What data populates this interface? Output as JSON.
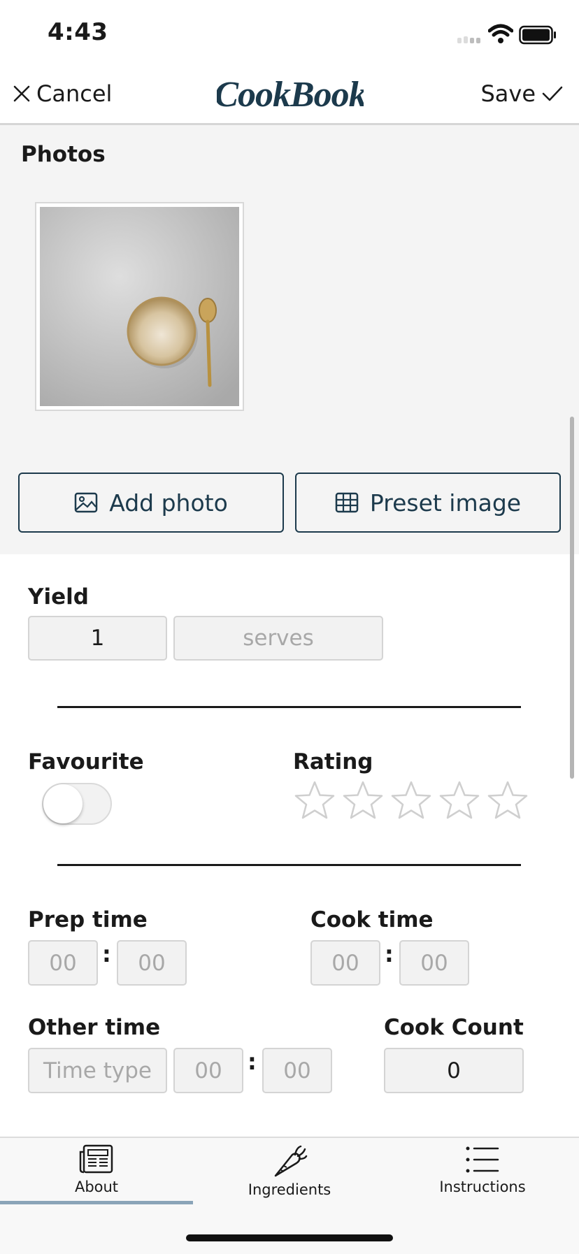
{
  "status_bar": {
    "time": "4:43"
  },
  "nav": {
    "cancel_label": "Cancel",
    "logo_text": "CookBook",
    "save_label": "Save"
  },
  "photos": {
    "title": "Photos",
    "add_photo_label": "Add photo",
    "preset_image_label": "Preset image"
  },
  "yield": {
    "label": "Yield",
    "value": "1",
    "unit_placeholder": "serves"
  },
  "favourite": {
    "label": "Favourite",
    "on": false
  },
  "rating": {
    "label": "Rating",
    "stars": 0,
    "max": 5
  },
  "prep_time": {
    "label": "Prep time",
    "hours_placeholder": "00",
    "minutes_placeholder": "00"
  },
  "cook_time": {
    "label": "Cook time",
    "hours_placeholder": "00",
    "minutes_placeholder": "00"
  },
  "other_time": {
    "label": "Other time",
    "type_placeholder": "Time type",
    "hours_placeholder": "00",
    "minutes_placeholder": "00"
  },
  "cook_count": {
    "label": "Cook Count",
    "value": "0"
  },
  "tabs": [
    {
      "label": "About",
      "icon": "newspaper-icon",
      "active": true
    },
    {
      "label": "Ingredients",
      "icon": "carrot-icon",
      "active": false
    },
    {
      "label": "Instructions",
      "icon": "list-icon",
      "active": false
    }
  ],
  "colors": {
    "accent": "#1c3a4c",
    "tab_indicator": "#8aa4b8"
  }
}
